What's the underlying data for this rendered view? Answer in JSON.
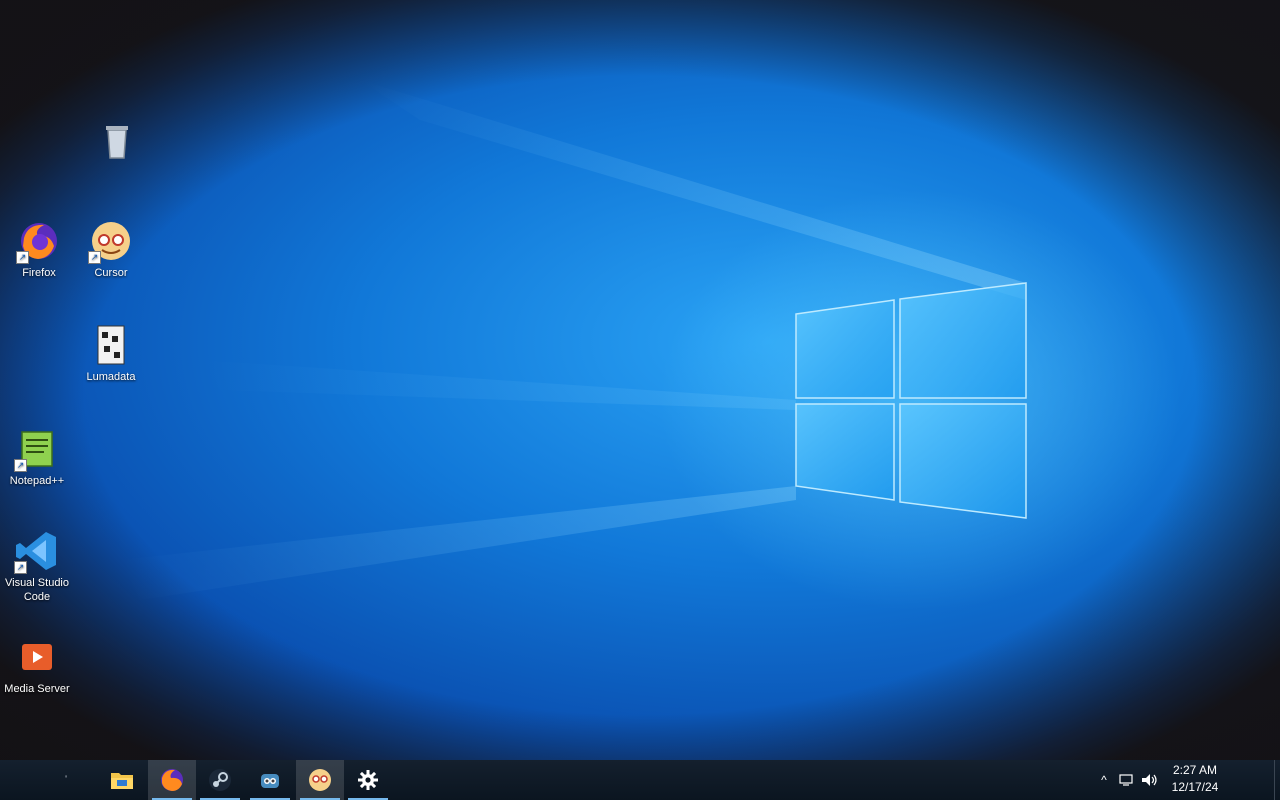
{
  "desktop": {
    "icons": [
      {
        "label": "",
        "icon": "recycle-bin-icon"
      },
      {
        "label": "Firefox",
        "icon": "firefox-icon"
      },
      {
        "label": "Cursor",
        "icon": "cursor-app-icon"
      },
      {
        "label": "Lumadata",
        "icon": "lumadata-icon"
      },
      {
        "label": "Notepad++",
        "icon": "notepadpp-icon"
      },
      {
        "label": "Visual Studio Code",
        "icon": "vscode-icon"
      },
      {
        "label": "Media Server",
        "icon": "media-server-icon"
      }
    ]
  },
  "taskbar": {
    "buttons": [
      {
        "name": "file-explorer",
        "icon": "folder-icon"
      },
      {
        "name": "firefox",
        "icon": "firefox-icon"
      },
      {
        "name": "steam",
        "icon": "steam-icon"
      },
      {
        "name": "godot",
        "icon": "godot-icon"
      },
      {
        "name": "cursor",
        "icon": "cursor-app-icon"
      },
      {
        "name": "settings",
        "icon": "gear-icon"
      }
    ],
    "tray": {
      "chevron": "^",
      "time": "2:27 AM",
      "date": "12/17/24"
    }
  },
  "colors": {
    "taskbar_bg": "#0b1520",
    "accent": "#76b9ed",
    "wallpaper_center": "#2aa3f5",
    "wallpaper_edge": "#082a6b"
  }
}
